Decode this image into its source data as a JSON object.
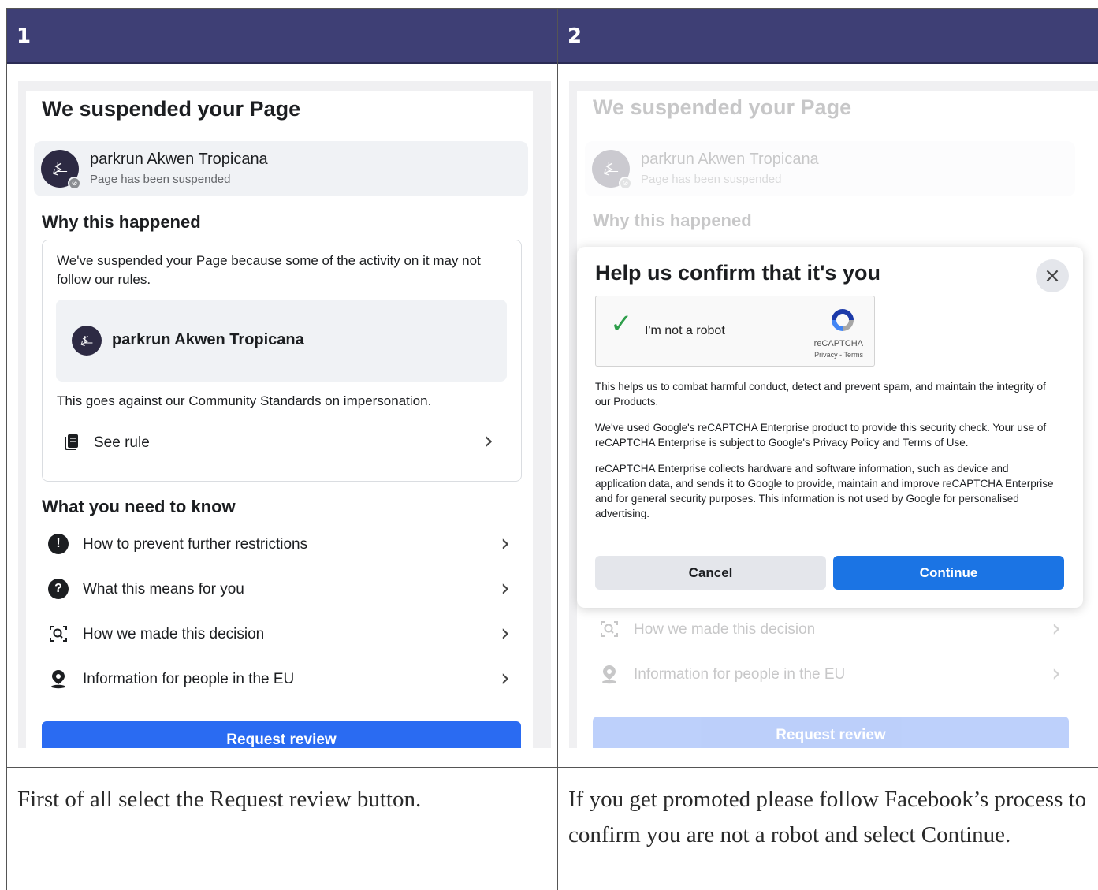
{
  "steps": [
    {
      "number": "1",
      "caption": "First of all select the Request review button."
    },
    {
      "number": "2",
      "caption": "If you get promoted please follow Facebook’s process to confirm you are not a robot and select Continue."
    }
  ],
  "suspension": {
    "title": "We suspended your Page",
    "page_name": "parkrun Akwen Tropicana",
    "page_status": "Page has been suspended",
    "why_heading": "Why this happened",
    "reason": "We've suspended your Page because some of the activity on it may not follow our rules.",
    "standard": "This goes against our Community Standards on impersonation.",
    "see_rule": "See rule",
    "know_heading": "What you need to know",
    "know_items": [
      {
        "label": "How to prevent further restrictions",
        "icon": "exclamation-icon"
      },
      {
        "label": "What this means for you",
        "icon": "question-icon"
      },
      {
        "label": "How we made this decision",
        "icon": "magnifier-icon"
      },
      {
        "label": "Information for people in the EU",
        "icon": "location-pin-icon"
      }
    ],
    "request_review": "Request review"
  },
  "modal": {
    "title": "Help us confirm that it's you",
    "captcha_label": "I'm not a robot",
    "captcha_brand": "reCAPTCHA",
    "captcha_links": "Privacy - Terms",
    "para1": "This helps us to combat harmful conduct, detect and prevent spam, and maintain the integrity of our Products.",
    "para2": "We've used Google's reCAPTCHA Enterprise product to provide this security check. Your use of reCAPTCHA Enterprise is subject to Google's Privacy Policy and Terms of Use.",
    "para3": "reCAPTCHA Enterprise collects hardware and software information, such as device and application data, and sends it to Google to provide, maintain and improve reCAPTCHA Enterprise and for general security purposes. This information is not used by Google for personalised advertising.",
    "cancel": "Cancel",
    "continue": "Continue"
  },
  "colors": {
    "header": "#3e3f75",
    "primary_button": "#2a6bf2",
    "continue_button": "#1b74e4",
    "check": "#2e9e4b"
  }
}
